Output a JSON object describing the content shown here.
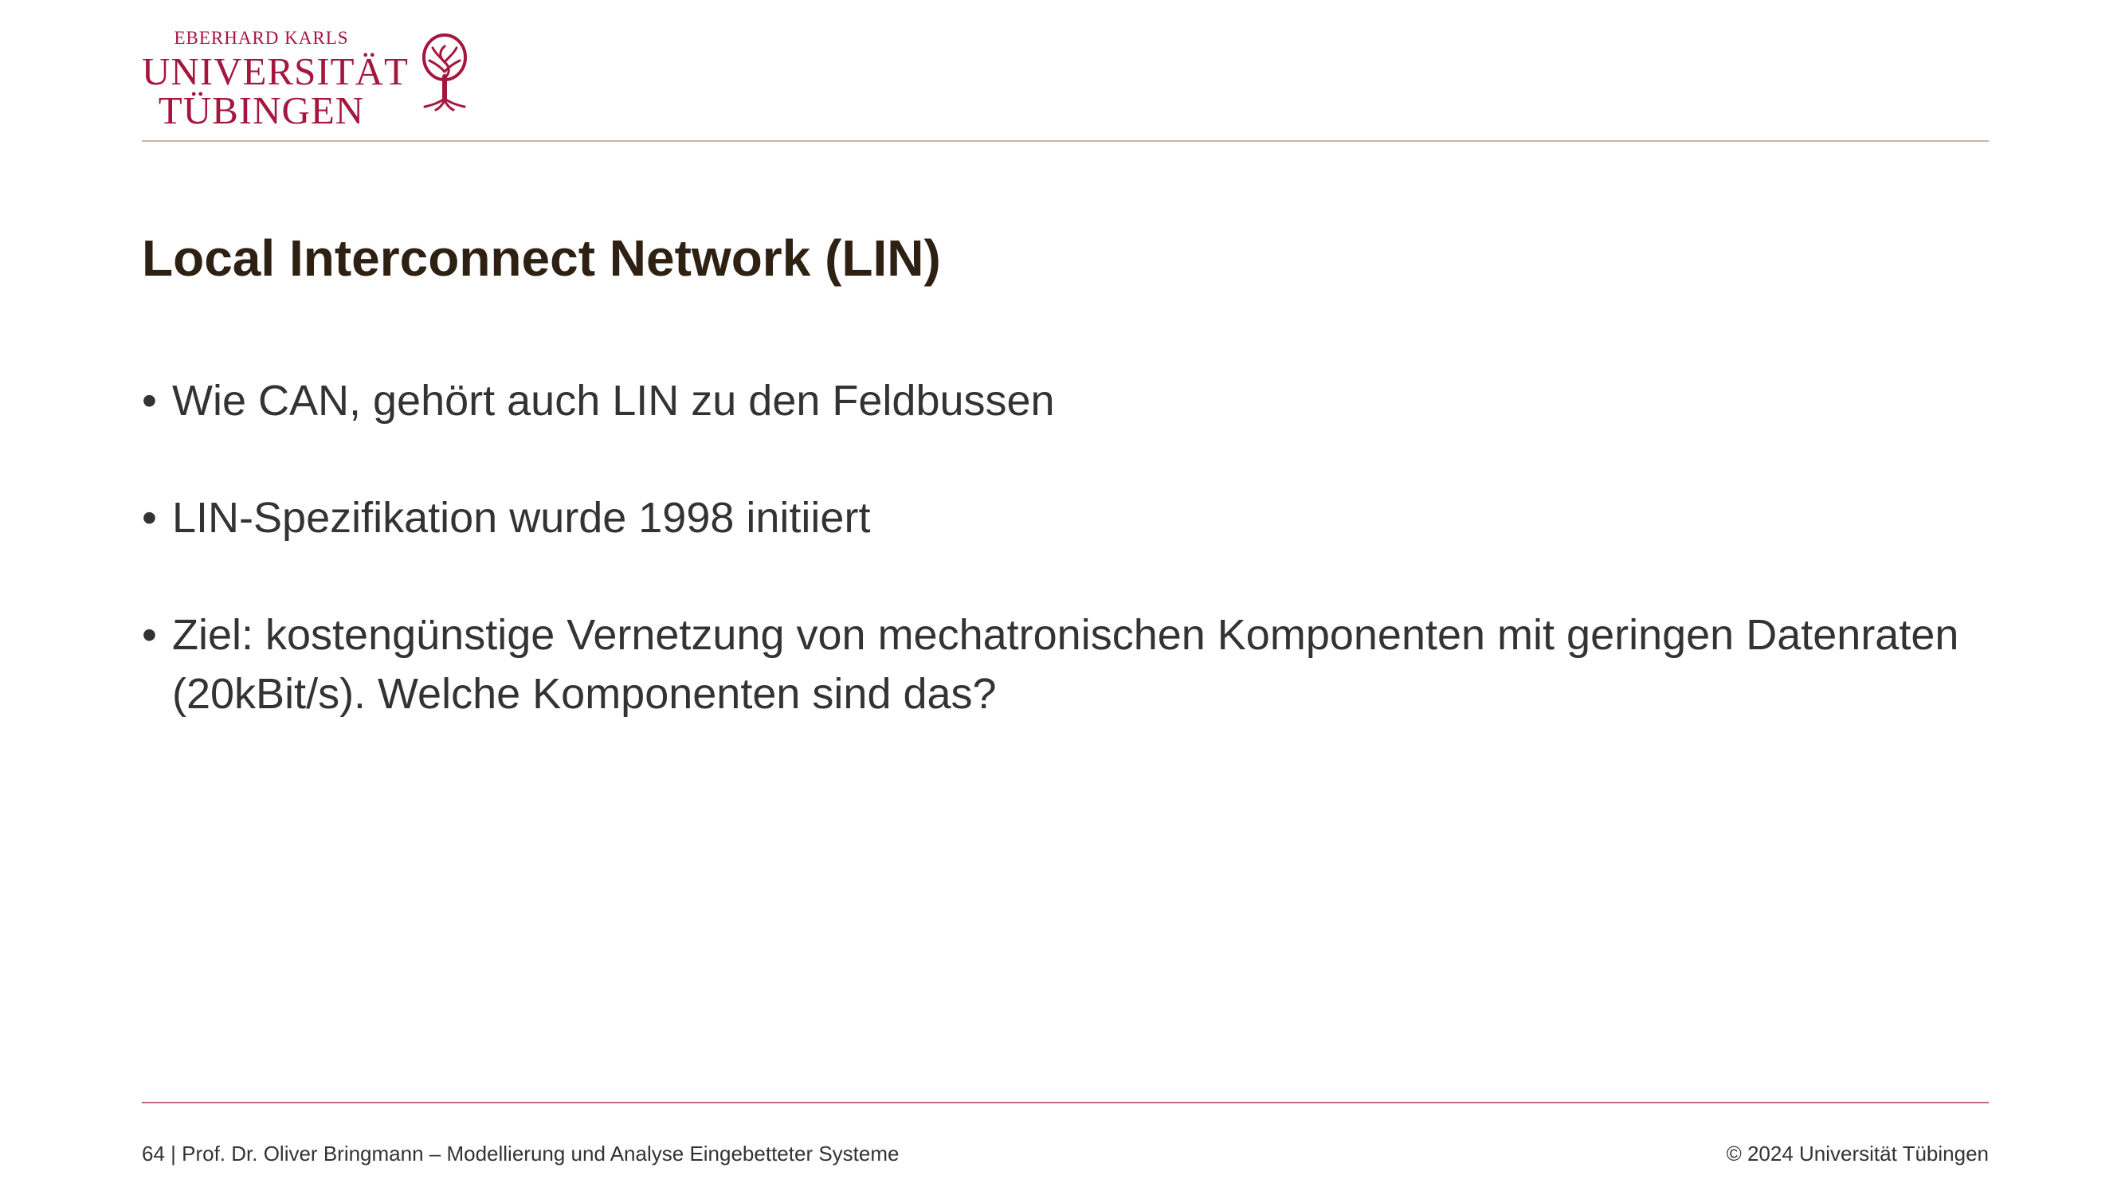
{
  "logo": {
    "line1": "EBERHARD KARLS",
    "line2": "UNIVERSITÄT",
    "line3": "TÜBINGEN",
    "color": "#a5163e",
    "icon": "tree-icon"
  },
  "slide": {
    "title": "Local Interconnect Network (LIN)",
    "bullets": [
      "Wie CAN, gehört auch LIN zu den Feldbussen",
      "LIN-Spezifikation wurde 1998 initiiert",
      "Ziel: kostengünstige Vernetzung von mechatronischen Komponenten mit geringen Datenraten (20kBit/s). Welche Komponenten sind das?"
    ],
    "bullet_glyph": "•"
  },
  "footer": {
    "left": "64 | Prof. Dr. Oliver Bringmann – Modellierung und Analyse Eingebetteter Systeme",
    "right": "© 2024 Universität Tübingen"
  },
  "colors": {
    "title": "#2e2114",
    "text": "#333333",
    "top_rule": "#c9b7a0",
    "bottom_rule": "#c46b83"
  }
}
